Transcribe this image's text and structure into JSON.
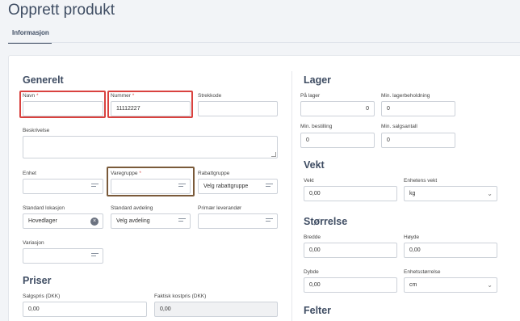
{
  "page": {
    "title": "Opprett produkt",
    "tab": "Informasjon"
  },
  "sections": {
    "generelt": "Generelt",
    "priser": "Priser",
    "lager": "Lager",
    "vekt": "Vekt",
    "storrelse": "Størrelse",
    "felter": "Felter"
  },
  "generelt": {
    "navn_label": "Navn",
    "navn_value": "",
    "nummer_label": "Nummer",
    "nummer_value": "11112227",
    "strekkode_label": "Strekkode",
    "strekkode_value": "",
    "beskrivelse_label": "Beskrivelse",
    "enhet_label": "Enhet",
    "varegruppe_label": "Varegruppe",
    "rabattgruppe_label": "Rabattgruppe",
    "rabattgruppe_value": "Velg rabattgruppe",
    "lokasjon_label": "Standard lokasjon",
    "lokasjon_value": "Hovedlager",
    "avdeling_label": "Standard avdeling",
    "avdeling_value": "Velg avdeling",
    "leverandor_label": "Primær leverandør",
    "variasjon_label": "Variasjon",
    "required_mark": "*"
  },
  "priser": {
    "salgspris_label": "Salgspris (DKK)",
    "salgspris_value": "0,00",
    "kostpris_label": "Faktisk kostpris (DKK)",
    "kostpris_value": "0,00"
  },
  "lager": {
    "pa_lager_label": "På lager",
    "pa_lager_value": "0",
    "min_beholdning_label": "Min. lagerbeholdning",
    "min_beholdning_value": "0",
    "min_bestilling_label": "Min. bestilling",
    "min_bestilling_value": "0",
    "min_salgsantall_label": "Min. salgsantall",
    "min_salgsantall_value": "0"
  },
  "vekt": {
    "vekt_label": "Vekt",
    "vekt_value": "0,00",
    "enhet_label": "Enhetens vekt",
    "enhet_value": "kg"
  },
  "storrelse": {
    "bredde_label": "Bredde",
    "bredde_value": "0,00",
    "hoyde_label": "Høyde",
    "hoyde_value": "0,00",
    "dybde_label": "Dybde",
    "dybde_value": "0,00",
    "enhet_label": "Enhetsstørrelse",
    "enhet_value": "cm"
  },
  "colors": {
    "heading": "#3f4d63",
    "highlight_red": "#d9423f",
    "highlight_brown": "#7a5a3a",
    "required": "#d9534f"
  }
}
